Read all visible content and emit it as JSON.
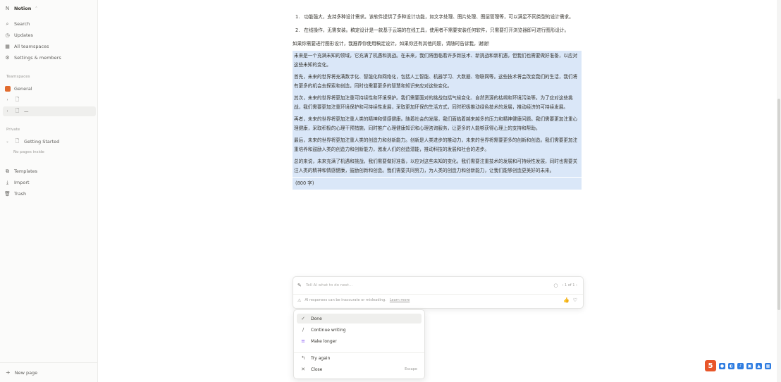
{
  "sidebar": {
    "workspace_name": "Notion",
    "workspace_chevron": "⌃",
    "nav": [
      {
        "label": "Search",
        "icon": "search-icon"
      },
      {
        "label": "Updates",
        "icon": "clock-icon"
      },
      {
        "label": "All teamspaces",
        "icon": "grid-icon"
      },
      {
        "label": "Settings & members",
        "icon": "gear-icon"
      }
    ],
    "teamspaces_heading": "Teamspaces",
    "general_label": "General",
    "page1_label": "",
    "page2_label": "—",
    "private_heading": "Private",
    "getting_started_label": "Getting Started",
    "no_pages_inside": "No pages inside",
    "bottom_nav": [
      {
        "label": "Templates",
        "icon": "templates-icon"
      },
      {
        "label": "Import",
        "icon": "import-icon"
      },
      {
        "label": "Trash",
        "icon": "trash-icon"
      }
    ],
    "new_page_label": "New page"
  },
  "document": {
    "list_items": [
      {
        "num": "1.",
        "text": "功能强大，支持多种设计需求。该软件提供了多种设计功能，如文字处理、图片处理、图层管理等，可以满足不同类型的设计需求。"
      },
      {
        "num": "2.",
        "text": "在线操作，无需安装。稿定设计是一款基于云端的在线工具，使用者不需要安装任何软件，只需要打开浏览器即可进行图形设计。"
      }
    ],
    "intro": "如果你需要进行图形设计，我推荐你使用稿定设计。如果你还有其他问题，请随时告诉我，谢谢！",
    "selected_paragraphs": [
      "未来是一个充满未知的领域，它充满了机遇和挑战。在未来，我们将面临着许多新技术、新挑战和新机遇，但我们也需要做好准备，以应对这些未知的变化。",
      "首先，未来的世界将充满数字化、智能化和网络化，包括人工智能、机器学习、大数据、物联网等。这些技术将会改变我们的生活，我们将有更多的机会去探索和创造，同时也需要更多的智慧和知识来应对这些变化。",
      "其次，未来的世界将更加注重可持续性和环境保护。我们需要面对的挑战包括气候变化、自然资源的枯竭和环境污染等。为了应对这些挑战，我们需要更加注重环境保护和可持续性发展，采取更加环保的生活方式，同时积极推动绿色技术的发展，推动经济的可持续发展。",
      "再者，未来的世界将更加注重人类的精神和情感健康。随着社会的发展，我们面临着越来越多的压力和精神健康问题。我们需要更加注重心理健康，采取积极的心理干预措施，同时推广心理健康知识和心理咨询服务，让更多的人能够获得心理上的支持和帮助。",
      "最后，未来的世界将更加注重人类的创造力和创新能力。创新是人类进步的推动力，未来的世界将需要更多的创新和创造。我们需要更加注重培养和鼓励人类的创造力和创新能力，激发人们的创造潜能，推动科技的发展和社会的进步。",
      "总的来说，未来充满了机遇和挑战，我们需要做好准备，以应对这些未知的变化。我们需要注重技术的发展和可持续性发展，同时也需要关注人类的精神和情感健康，鼓励创新和创造。我们需要共同努力，为人类的创造力和创新能力，让我们能够创造更美好的未来。"
    ],
    "char_count": "(800 字)"
  },
  "ai_box": {
    "placeholder": "Tell AI what to do next...",
    "page_indicator": "‹  1 of 1  ›",
    "disclaimer": "AI responses can be inaccurate or misleading.",
    "learn_more": "Learn more"
  },
  "menu": {
    "items": [
      {
        "label": "Done",
        "icon": "check-icon",
        "glyph": "✓",
        "shortcut": ""
      },
      {
        "label": "Continue writing",
        "icon": "pen-icon",
        "glyph": "∕",
        "shortcut": ""
      },
      {
        "label": "Make longer",
        "icon": "lines-icon",
        "glyph": "≡",
        "shortcut": ""
      },
      {
        "label": "Try again",
        "icon": "retry-icon",
        "glyph": "↰",
        "shortcut": ""
      },
      {
        "label": "Close",
        "icon": "close-icon",
        "glyph": "✕",
        "shortcut": "Escape"
      }
    ]
  },
  "tray": {
    "app_badge": "5"
  },
  "colors": {
    "selection": "#dae7f8",
    "sidebar_bg": "#fbfbfa",
    "accent_orange": "#e8562a"
  }
}
